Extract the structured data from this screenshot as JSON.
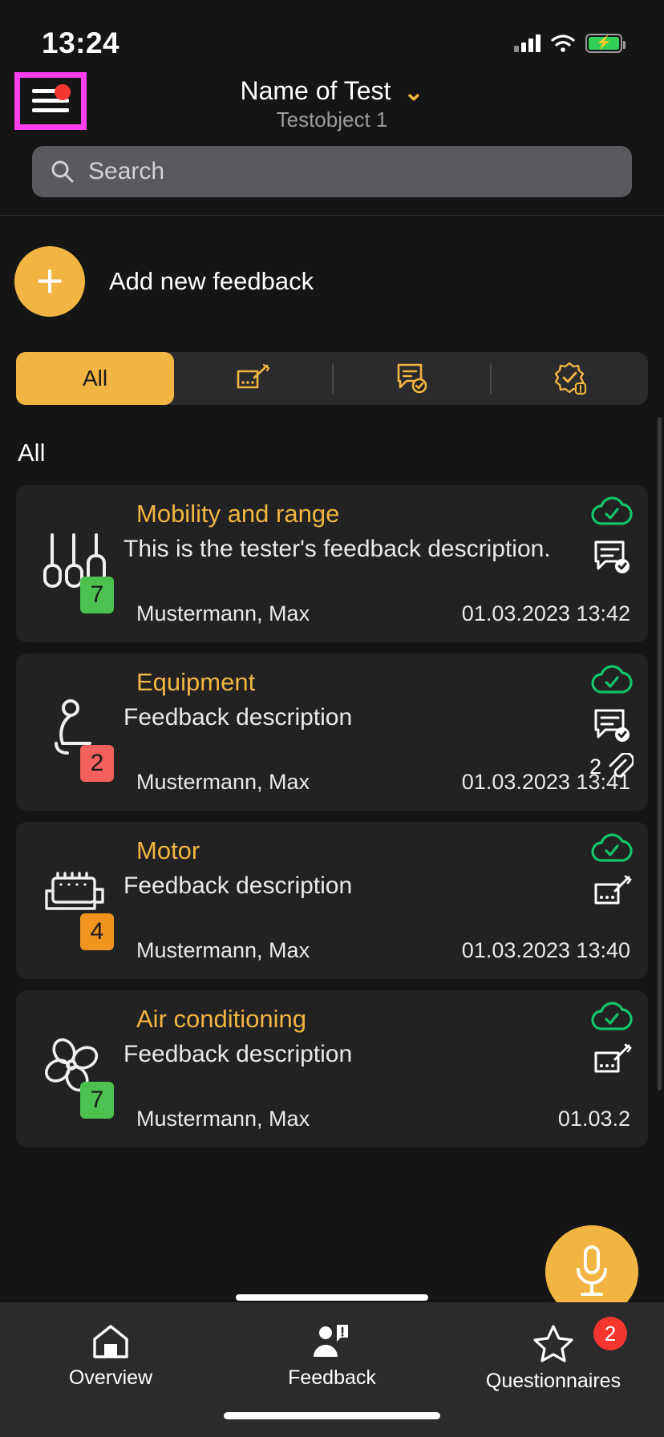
{
  "status_bar": {
    "time": "13:24",
    "signal_icon": "cellular-signal-icon",
    "wifi_icon": "wifi-icon",
    "battery_icon": "battery-charging-icon"
  },
  "header": {
    "menu_icon": "hamburger-menu-icon",
    "menu_has_notification": true,
    "title": "Name of Test",
    "subtitle": "Testobject 1",
    "dropdown_icon": "chevron-down-icon"
  },
  "search": {
    "placeholder": "Search",
    "icon": "search-icon"
  },
  "add_feedback": {
    "label": "Add new feedback",
    "icon": "plus-icon"
  },
  "filter_tabs": [
    {
      "label": "All",
      "icon": "",
      "selected": true
    },
    {
      "label": "",
      "icon": "signature-edit-icon",
      "selected": false
    },
    {
      "label": "",
      "icon": "comment-check-icon",
      "selected": false
    },
    {
      "label": "",
      "icon": "quality-badge-alert-icon",
      "selected": false
    }
  ],
  "section": {
    "label": "All"
  },
  "feedback_items": [
    {
      "title": "Mobility and range",
      "description": "This is the tester's feedback description.",
      "author": "Mustermann, Max",
      "date": "01.03.2023 13:42",
      "badge_value": "7",
      "badge_color": "#4cc14f",
      "category_icon": "mobility-range-icon",
      "sync_icon": "cloud-check-icon",
      "status_icon": "comment-check-icon",
      "attachment_count": ""
    },
    {
      "title": "Equipment",
      "description": "Feedback description",
      "author": "Mustermann, Max",
      "date": "01.03.2023 13:41",
      "badge_value": "2",
      "badge_color": "#f4615c",
      "category_icon": "seat-equipment-icon",
      "sync_icon": "cloud-check-icon",
      "status_icon": "comment-check-icon",
      "attachment_count": "2"
    },
    {
      "title": "Motor",
      "description": "Feedback description",
      "author": "Mustermann, Max",
      "date": "01.03.2023 13:40",
      "badge_value": "4",
      "badge_color": "#f0941f",
      "category_icon": "motor-engine-icon",
      "sync_icon": "cloud-check-icon",
      "status_icon": "signature-edit-icon",
      "attachment_count": ""
    },
    {
      "title": "Air conditioning",
      "description": "Feedback description",
      "author": "Mustermann, Max",
      "date": "01.03.2",
      "badge_value": "7",
      "badge_color": "#4cc14f",
      "category_icon": "fan-air-conditioning-icon",
      "sync_icon": "cloud-check-icon",
      "status_icon": "signature-edit-icon",
      "attachment_count": ""
    }
  ],
  "voice_button": {
    "icon": "microphone-icon"
  },
  "bottom_nav": [
    {
      "label": "Overview",
      "icon": "home-icon",
      "badge": ""
    },
    {
      "label": "Feedback",
      "icon": "person-alert-icon",
      "badge": ""
    },
    {
      "label": "Questionnaires",
      "icon": "star-icon",
      "badge": "2"
    }
  ],
  "colors": {
    "accent": "#f2b541",
    "background": "#151515",
    "card": "#222223",
    "success": "#12c46b",
    "danger": "#f5372f",
    "highlight": "#ff3ef0"
  }
}
